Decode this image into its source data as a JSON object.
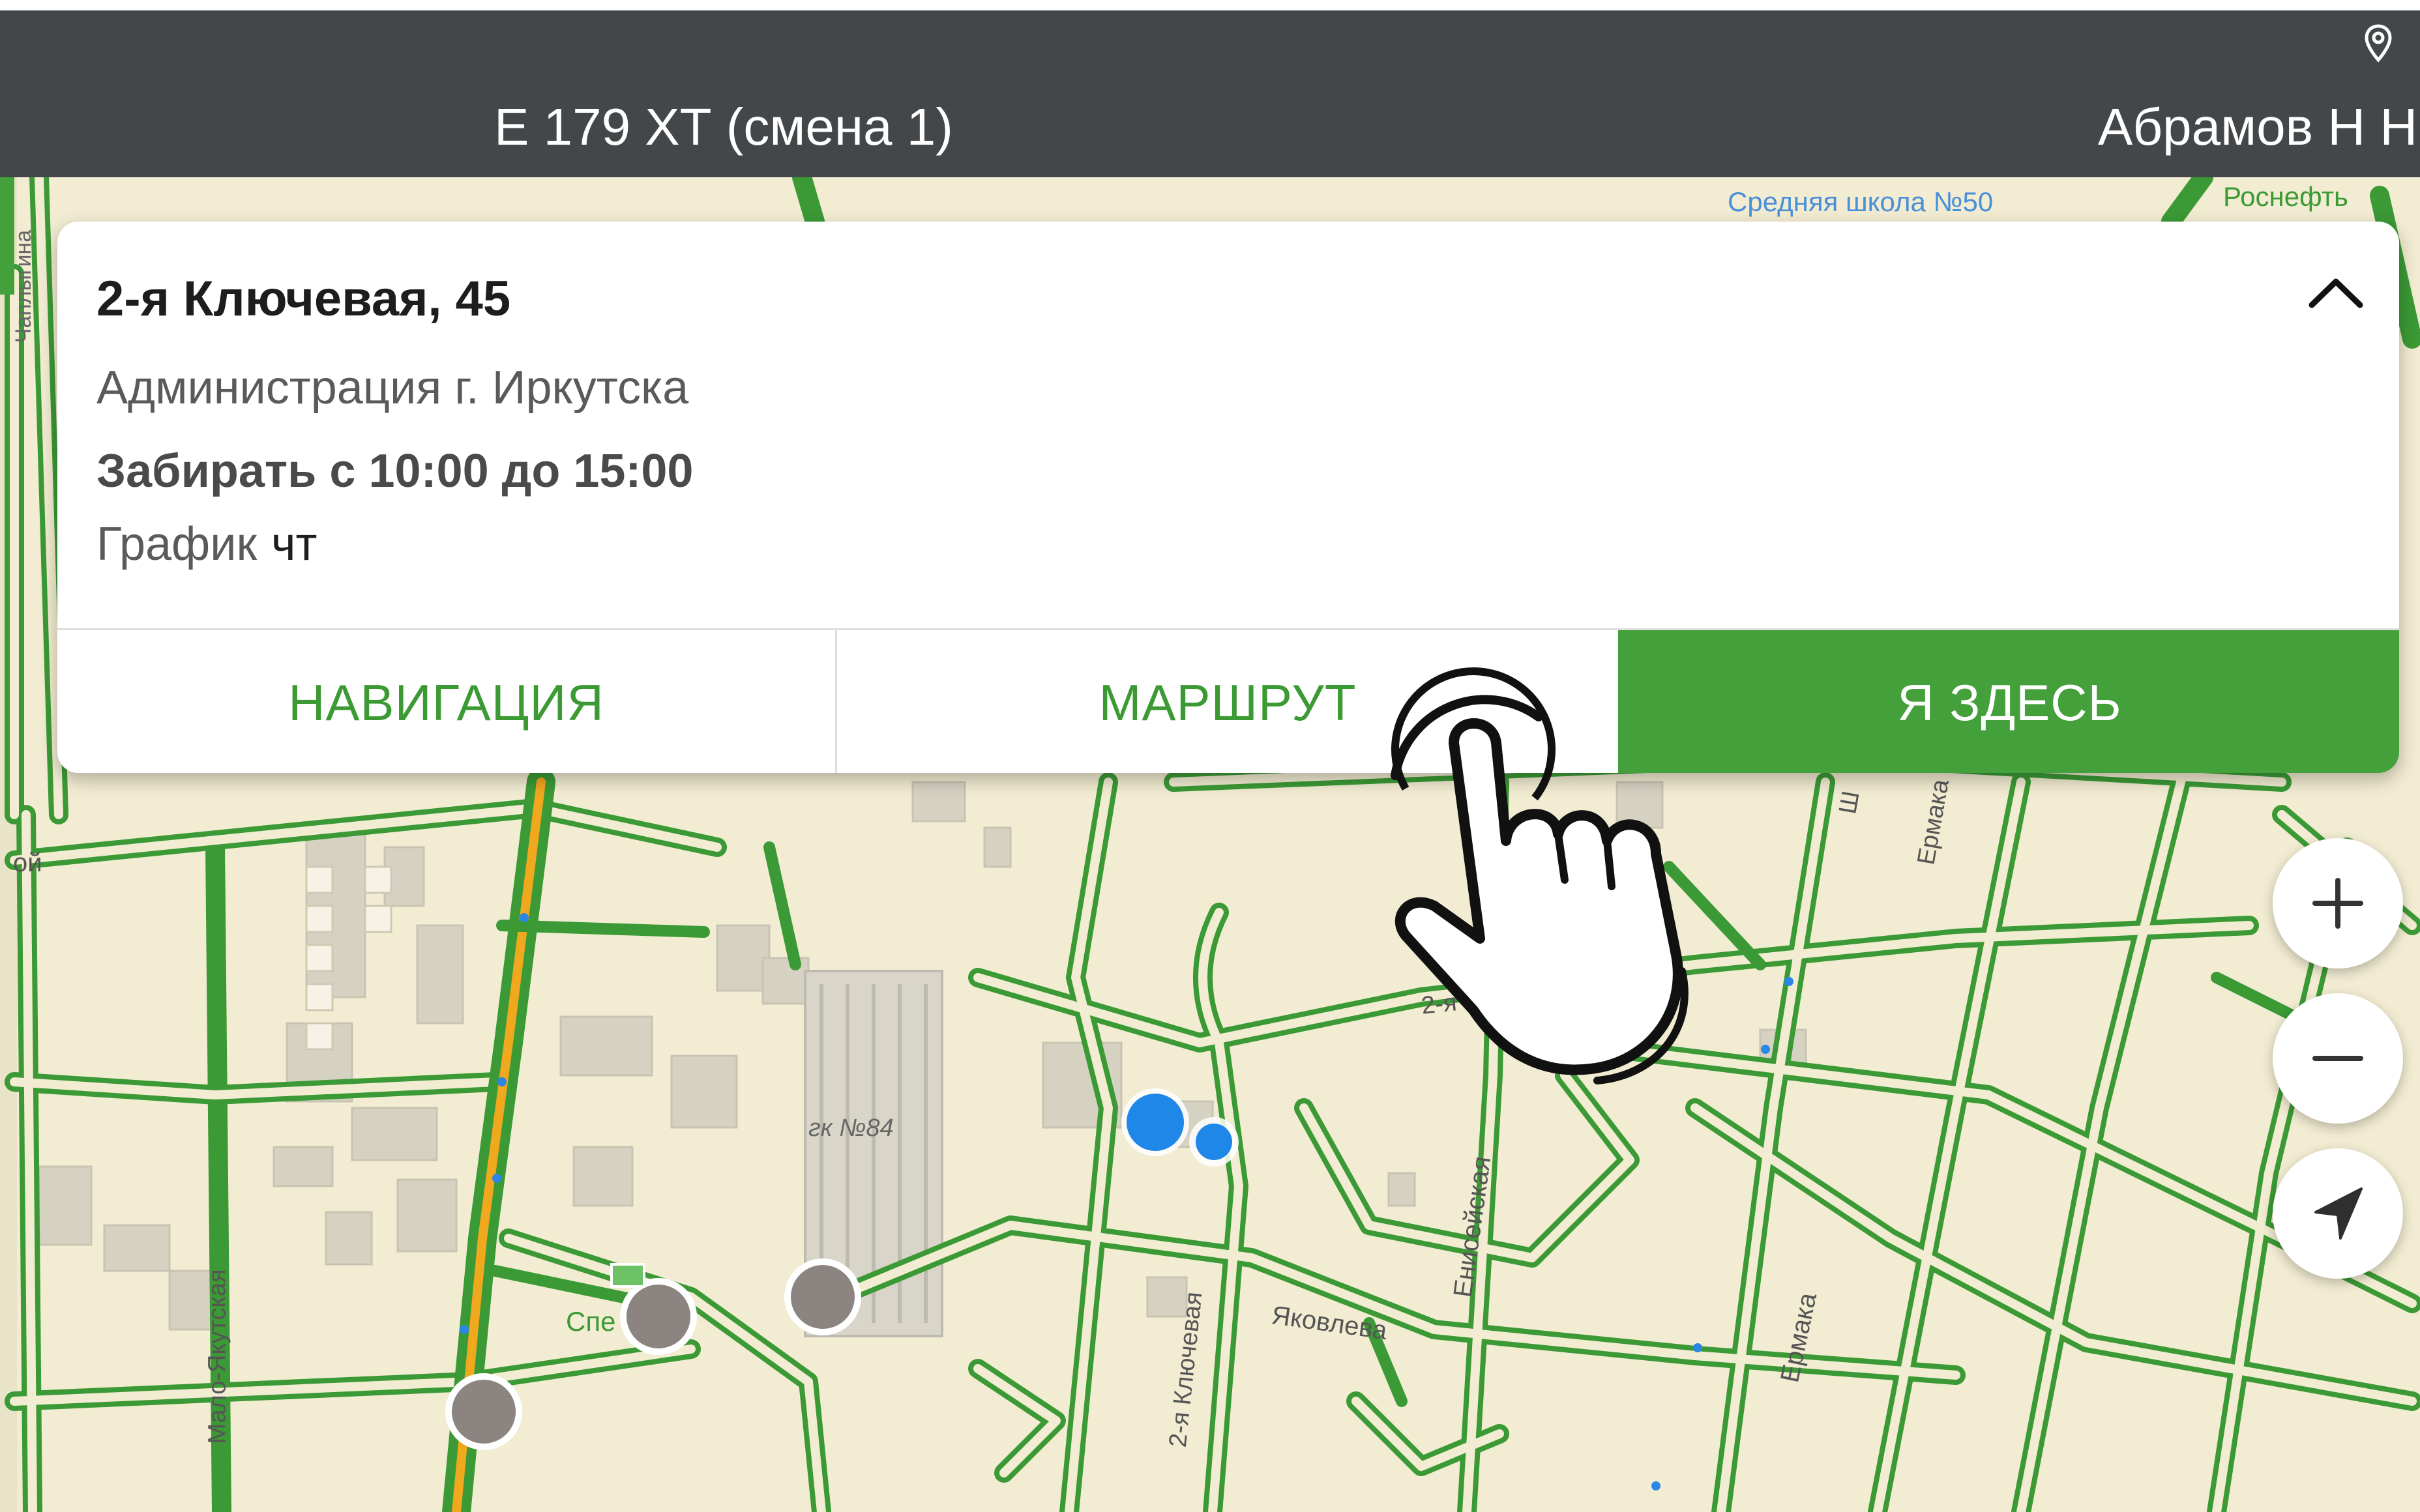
{
  "header": {
    "vehicle": "Е 179 ХТ (смена 1)",
    "driver": "Абрамов Н Н"
  },
  "card": {
    "address": "2-я Ключевая, 45",
    "organization": "Администрация г. Иркутска",
    "pickup_window": "Забирать с 10:00 до 15:00",
    "schedule_label": "График",
    "schedule_days": "чт",
    "buttons": {
      "navigation": "НАВИГАЦИЯ",
      "route": "МАРШРУТ",
      "here": "Я ЗДЕСЬ"
    }
  },
  "map": {
    "labels": {
      "school": "Средняя школа №50",
      "rusneft": "Роснефть",
      "garage": "гк №84",
      "street_2nd_s": "2-я С",
      "yakovleva": "Яковлева",
      "eniseyskaya": "Енисейская",
      "ermaka_1": "Ермака",
      "ermaka_2": "Ермака",
      "klyuchevaya": "2-я Ключевая",
      "malo_yakutskaya": "Мало-Якутская",
      "spe": "Спе",
      "chaplygina": "Чаплыгина",
      "edge_oy": "ой",
      "edge_sh": "Ш"
    },
    "controls": {
      "zoom_in": "+",
      "zoom_out": "−"
    }
  },
  "colors": {
    "header": "#444749",
    "accent": "#44a03a",
    "map_background": "#f2ecd2",
    "road": "#3b9a35",
    "highway": "#f0a81e",
    "location_dot": "#1f87e8",
    "marker": "#8c8480"
  },
  "icons": {
    "location_pin": "map-pin-icon",
    "collapse": "chevron-up-icon",
    "locate": "navigation-arrow-icon",
    "hand": "hand-pointer-icon"
  }
}
